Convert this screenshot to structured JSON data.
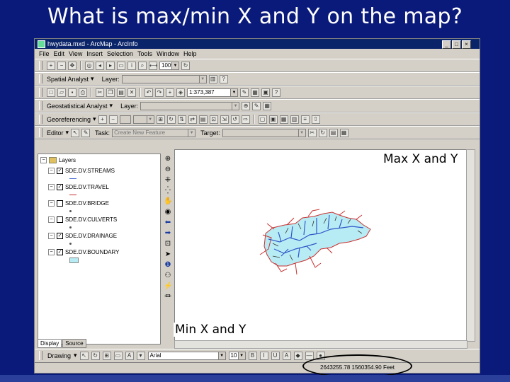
{
  "slide": {
    "title": "What is max/min X and Y on the map?",
    "callout_max": "Max X and Y",
    "callout_min": "Min X and Y",
    "background_color": "#0a1a7a"
  },
  "window": {
    "title": "hwydata.mxd - ArcMap - ArcInfo",
    "icon": "arcmap-icon",
    "controls": [
      "_",
      "□",
      "×"
    ]
  },
  "menu": [
    "File",
    "Edit",
    "View",
    "Insert",
    "Selection",
    "Tools",
    "Window",
    "Help"
  ],
  "toolbars": {
    "standard_zoom": "100%",
    "spatial_analyst_label": "Spatial Analyst",
    "spatial_analyst_layer_label": "Layer:",
    "scale_value": "1:373,387",
    "geostatistical_label": "Geostatistical Analyst",
    "geostatistical_layer_label": "Layer:",
    "georef_label": "Georeferencing",
    "editor_label": "Editor",
    "task_label": "Task:",
    "task_value": "Create New Feature",
    "target_label": "Target:"
  },
  "toc": {
    "root": "Layers",
    "layers": [
      {
        "name": "SDE.DV.STREAMS",
        "checked": true,
        "symbol": "line",
        "symbol_color": "#4a6fd6"
      },
      {
        "name": "SDE.DV.TRAVEL",
        "checked": true,
        "symbol": "line",
        "symbol_color": "#c83030"
      },
      {
        "name": "SDE.DV.BRIDGE",
        "checked": false,
        "symbol": "point",
        "symbol_color": "#555555"
      },
      {
        "name": "SDE.DV.CULVERTS",
        "checked": false,
        "symbol": "point",
        "symbol_color": "#555555"
      },
      {
        "name": "SDE.DV.DRAINAGE",
        "checked": true,
        "symbol": "point",
        "symbol_color": "#555555"
      },
      {
        "name": "SDE.DV.BOUNDARY",
        "checked": true,
        "symbol": "polygon",
        "symbol_color": "#b8ecf4"
      }
    ],
    "tabs": [
      "Display",
      "Source"
    ]
  },
  "drawing_toolbar": {
    "drawing_label": "Drawing",
    "font_value": "Arial",
    "font_size_value": "10"
  },
  "status": {
    "coordinates": "2643255.78  1560354.90 Feet"
  }
}
